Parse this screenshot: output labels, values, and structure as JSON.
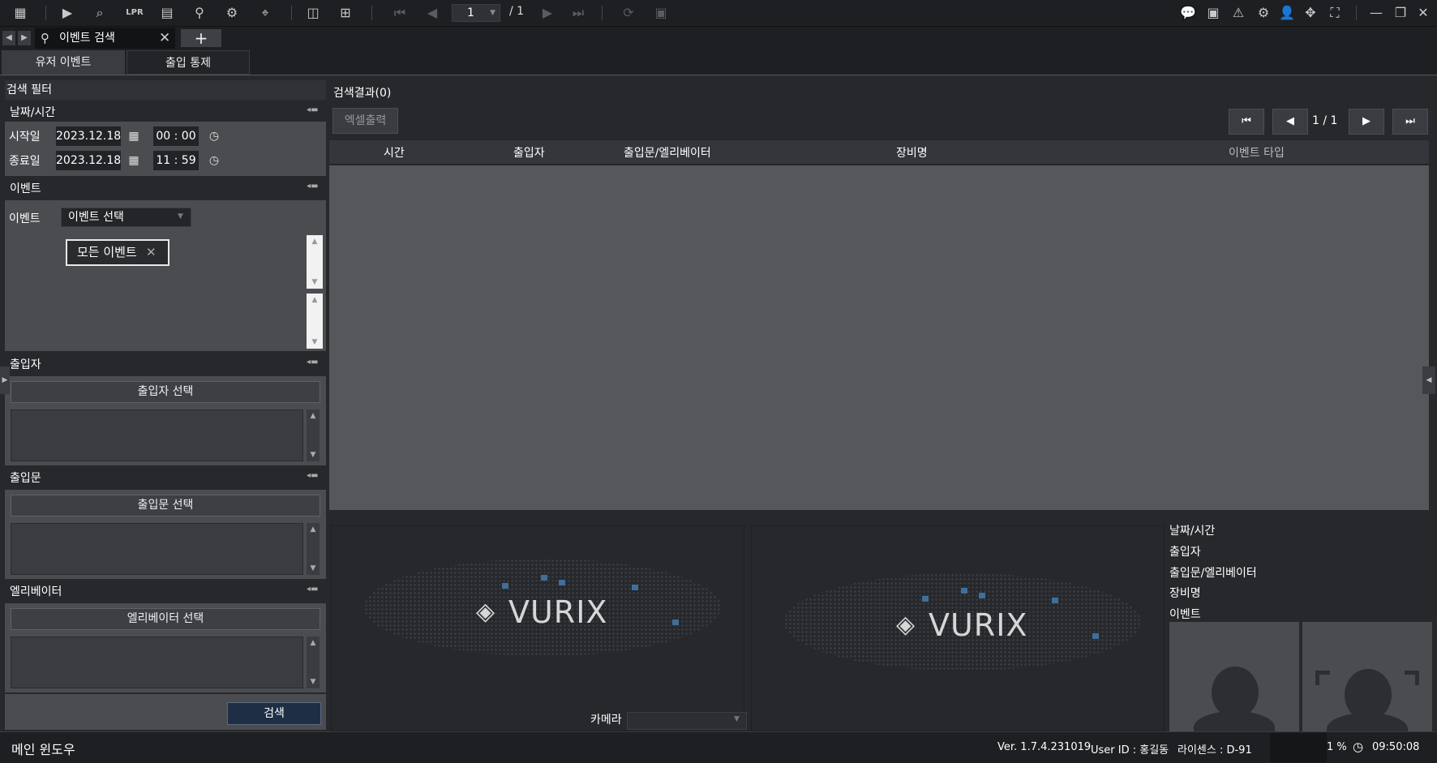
{
  "toolbar": {
    "page_current": "1",
    "page_total": "/ 1"
  },
  "tabs": {
    "doc_tab_label": "이벤트 검색",
    "add_tab_label": "+"
  },
  "subtabs": {
    "user_event": "유저 이벤트",
    "access_control": "출입 통제"
  },
  "filter": {
    "title": "검색 필터",
    "datetime": {
      "title": "날짜/시간",
      "start_label": "시작일",
      "start_date": "2023.12.18",
      "start_time": "00 : 00",
      "end_label": "종료일",
      "end_date": "2023.12.18",
      "end_time": "11 : 59"
    },
    "event": {
      "title": "이벤트",
      "label": "이벤트",
      "select_value": "이벤트 선택",
      "tag": "모든 이벤트"
    },
    "person": {
      "title": "출입자",
      "button": "출입자 선택"
    },
    "door": {
      "title": "출입문",
      "button": "출입문 선택"
    },
    "elevator": {
      "title": "엘리베이터",
      "button": "엘리베이터 선택"
    },
    "search_button": "검색"
  },
  "results": {
    "label": "검색결과(0)",
    "excel_button": "엑셀출력",
    "pagination": "1  /  1",
    "columns": [
      "시간",
      "출입자",
      "출입문/엘리베이터",
      "장비명",
      "이벤트 타입"
    ]
  },
  "preview": {
    "logo": "VURIX",
    "camera_label": "카메라",
    "info_labels": [
      "날짜/시간",
      "출입자",
      "출입문/엘리베이터",
      "장비명",
      "이벤트"
    ]
  },
  "status": {
    "main_window": "메인 윈도우",
    "version": "Ver. 1.7.4.231019",
    "user_id": "User ID : 홍길동",
    "license": "라이센스 : D-91",
    "cpu": "1 %",
    "clock": "09:50:08"
  },
  "colors": {
    "background": "#2b2d31",
    "toolbar": "#1e1f22",
    "table_body": "#55575b",
    "map_pin": "#3f6f9a"
  }
}
